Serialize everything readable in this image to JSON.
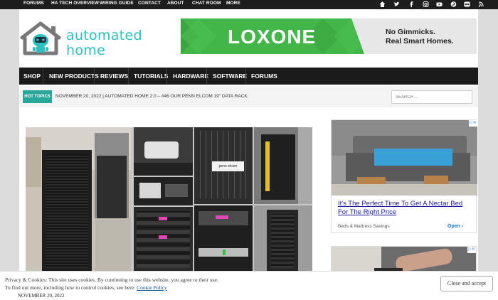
{
  "topbar": {
    "links": [
      "FORUMS",
      "HA TECH OVERVIEW",
      "WIRING GUIDE",
      "CONTACT",
      "ABOUT",
      "CHAT ROOM",
      "MORE"
    ],
    "social_icons": [
      "home-icon",
      "twitter-icon",
      "facebook-icon",
      "instagram-icon",
      "youtube-icon",
      "pinterest-icon",
      "flickr-icon",
      "rss-icon"
    ]
  },
  "logo": {
    "line1": "automated",
    "line2": "home"
  },
  "ad_banner": {
    "brand": "LOXONE",
    "tagline1": "No Gimmicks.",
    "tagline2": "Real Smart Homes."
  },
  "nav": {
    "items": [
      "SHOP",
      "NEW PRODUCTS",
      "REVIEWS",
      "TUTORIALS",
      "HARDWARE",
      "SOFTWARE",
      "FORUMS"
    ]
  },
  "hot_topics": {
    "label": "HOT TOPICS",
    "date": "NOVEMBER 20, 2022",
    "headline": "AUTOMATED HOME 2.0 – #46 OUR PENN ELCOM 19\" DATA RACK"
  },
  "search": {
    "placeholder": "SEARCH ..."
  },
  "side_ad": {
    "headline1": "It's The Perfect Time To Get A Nectar Bed",
    "headline2": "For The Right Price",
    "source": "Beds & Mattress Savings",
    "cta": "Open"
  },
  "article": {
    "photo_label": "penn elcom"
  },
  "cookie": {
    "line1": "Privacy & Cookies: This site uses cookies. By continuing to use this website, you agree to their use.",
    "line2_prefix": "To find out more, including how to control cookies, see here: ",
    "policy_link": "Cookie Policy",
    "button": "Close and accept",
    "post_date": "NOVEMBER 20, 2022"
  },
  "colors": {
    "accent": "#2bbfc0",
    "hot": "#2aa79b",
    "nav": "#1b1b1b",
    "loxone": "#43b649"
  }
}
